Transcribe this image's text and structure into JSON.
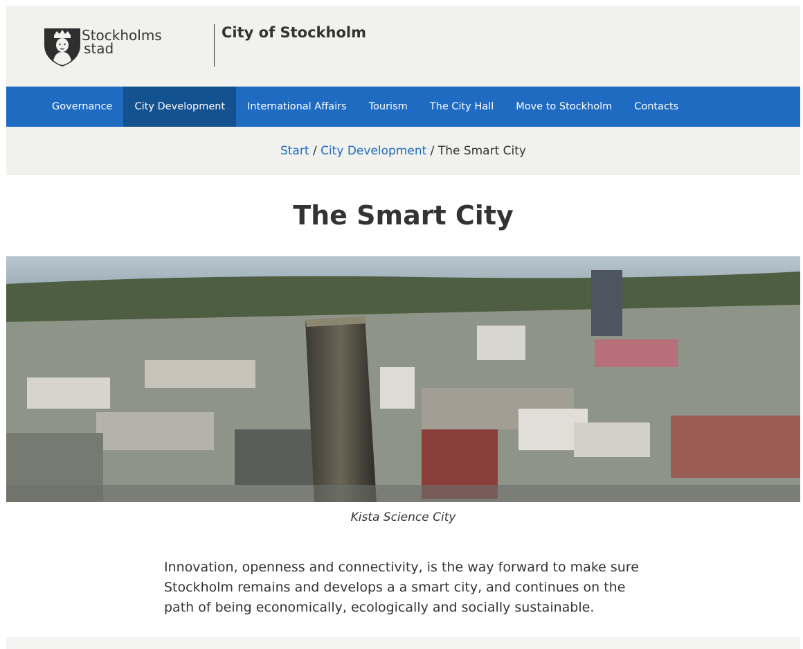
{
  "header": {
    "brand_line1": "Stockholms",
    "brand_line2": "stad",
    "site_title": "City of Stockholm"
  },
  "nav": {
    "items": [
      {
        "label": "Governance",
        "active": false
      },
      {
        "label": "City Development",
        "active": true
      },
      {
        "label": "International Affairs",
        "active": false
      },
      {
        "label": "Tourism",
        "active": false
      },
      {
        "label": "The City Hall",
        "active": false
      },
      {
        "label": "Move to Stockholm",
        "active": false
      },
      {
        "label": "Contacts",
        "active": false
      }
    ]
  },
  "breadcrumb": {
    "start": "Start",
    "sep1": "/",
    "section": "City Development",
    "sep2": "/",
    "current": "The Smart City"
  },
  "page": {
    "title": "The Smart City",
    "caption": "Kista Science City",
    "intro": "Innovation, openness and connectivity, is the way forward to make sure Stockholm remains and develops a a smart city, and continues on the path of being economically, ecologically and socially sustainable."
  },
  "colors": {
    "nav_bg": "#1f6bc1",
    "nav_active": "#14528f",
    "header_bg": "#f1f1ee",
    "link": "#1f6bc1"
  }
}
